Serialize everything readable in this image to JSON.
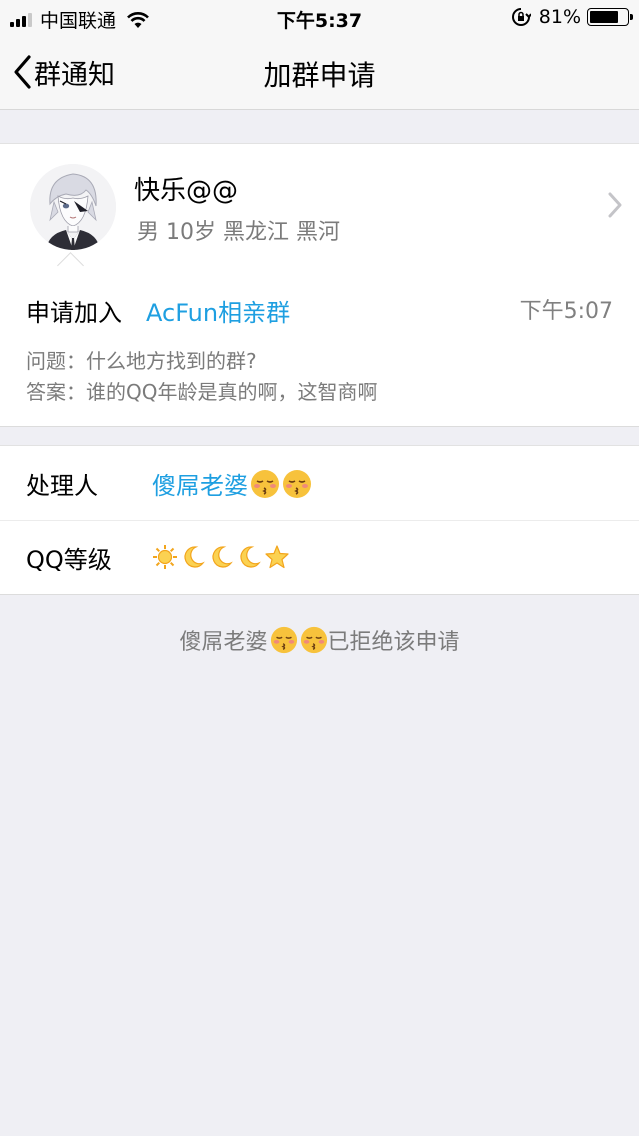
{
  "status_bar": {
    "carrier": "中国联通",
    "time": "下午5:37",
    "battery": "81%",
    "battery_level": 0.81
  },
  "nav": {
    "back_label": "群通知",
    "title": "加群申请"
  },
  "applicant": {
    "name": "快乐@@",
    "details": "男 10岁 黑龙江 黑河"
  },
  "request": {
    "label": "申请加入",
    "group_name": "AcFun相亲群",
    "time": "下午5:07",
    "question": "问题：什么地方找到的群?",
    "answer": "答案：谁的QQ年龄是真的啊，这智商啊"
  },
  "handler": {
    "label": "处理人",
    "name": "傻屌老婆"
  },
  "qq_level": {
    "label": "QQ等级",
    "icons": [
      "sun-icon",
      "moon-icon",
      "moon-icon",
      "moon-icon",
      "star-icon"
    ]
  },
  "footer": {
    "name": "傻屌老婆",
    "text": "已拒绝该申请"
  },
  "colors": {
    "link": "#1e9fe1",
    "background": "#efeff4"
  }
}
